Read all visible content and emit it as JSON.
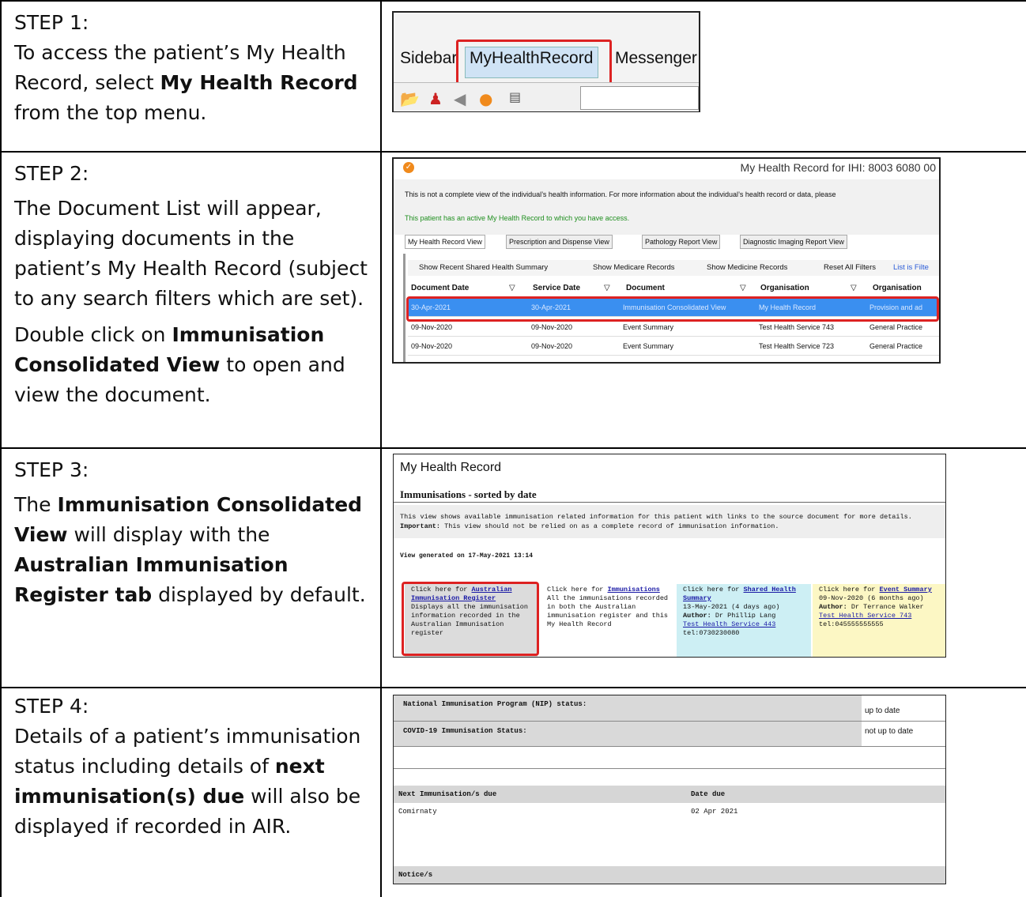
{
  "steps": [
    {
      "heading": "STEP 1:",
      "text_pre": "To access the patient’s My Health Record, select ",
      "text_bold": "My Health Record",
      "text_post": " from the top menu."
    },
    {
      "heading": "STEP 2:",
      "para1": "The Document List will appear, displaying documents in the patient’s My Health Record (subject to any search filters which are set).",
      "para2_pre": "Double click on ",
      "para2_bold": "Immunisation Consolidated View",
      "para2_post": " to open and view the document."
    },
    {
      "heading": "STEP 3:",
      "pre": "The ",
      "bold1": "Immunisation Consolidated View",
      "mid": " will display with the ",
      "bold2": "Australian Immunisation Register tab",
      "post": " displayed by default."
    },
    {
      "heading": "STEP 4:",
      "pre": "Details of a patient’s immunisation status including details of ",
      "bold": "next immunisation(s) due",
      "post": " will also be displayed if recorded in AIR."
    }
  ],
  "shot1": {
    "menu": [
      "Sidebar",
      "MyHealthRecord",
      "Messenger"
    ]
  },
  "shot2": {
    "title": "My Health Record for IHI: 8003 6080 00",
    "notice": "This is not a complete view of the individual’s health information. For more information about the individual’s health record or data, please",
    "active": "This patient has an active My Health Record to which you have access.",
    "tabs": [
      "My Health Record View",
      "Prescription and Dispense View",
      "Pathology Report View",
      "Diagnostic Imaging Report View"
    ],
    "buttons": [
      "Show Recent Shared Health Summary",
      "Show Medicare Records",
      "Show Medicine Records",
      "Reset All Filters",
      "List is Filte"
    ],
    "columns": [
      "Document Date",
      "Service Date",
      "Document",
      "Organisation",
      "Organisation"
    ],
    "rows": [
      [
        "30-Apr-2021",
        "30-Apr-2021",
        "Immunisation Consolidated View",
        "My Health Record",
        "Provision and ad"
      ],
      [
        "09-Nov-2020",
        "09-Nov-2020",
        "Event Summary",
        "Test Health Service 743",
        "General Practice"
      ],
      [
        "09-Nov-2020",
        "09-Nov-2020",
        "Event Summary",
        "Test Health Service 723",
        "General Practice"
      ]
    ]
  },
  "shot3": {
    "title": "My Health Record",
    "subtitle": "Immunisations - sorted by date",
    "info1": "This view shows available immunisation related information for this patient with links to the source document for more details.",
    "info2_label": "Important:",
    "info2": " This view should not be relied on as a complete record of immunisation information.",
    "generated": "View generated on 17-May-2021 13:14",
    "boxes": [
      {
        "pre": "Click here for ",
        "link": "Australian Immunisation Register",
        "body": "Displays all the immunisation information recorded in the Australian Immunisation register"
      },
      {
        "pre": "Click here for ",
        "link": "Immunisations",
        "body": "All the immunisations recorded in both the Australian immunisation register and this My Health Record"
      },
      {
        "pre": "Click here for ",
        "link": "Shared Health Summary",
        "date": "13-May-2021 (4 days ago)",
        "author_label": "Author:",
        "author": " Dr Phillip Lang",
        "org": "Test Health Service 443",
        "tel": "tel:0730230080"
      },
      {
        "pre": "Click here for ",
        "link": "Event Summary",
        "date": "09-Nov-2020 (6 months ago)",
        "author_label": "Author:",
        "author": " Dr Terrance Walker",
        "org": "Test Health Service 743",
        "tel": "tel:045555555555"
      }
    ]
  },
  "shot4": {
    "nip_label": "National Immunisation Program (NIP) status:",
    "nip_value": "up to date",
    "covid_label": "COVID-19 Immunisation Status:",
    "covid_value": "not up to date",
    "next_header": "Next Immunisation/s due",
    "date_header": "Date due",
    "next_item": "Comirnaty",
    "next_date": "02 Apr 2021",
    "notices": "Notice/s"
  }
}
